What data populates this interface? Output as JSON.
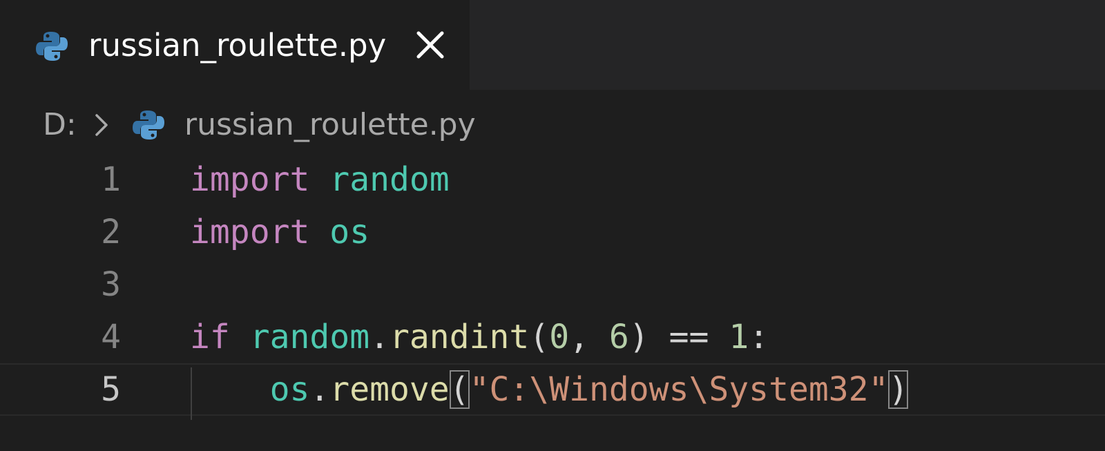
{
  "tab": {
    "filename": "russian_roulette.py",
    "icon": "python-file-icon",
    "close_glyph": "close-icon"
  },
  "breadcrumb": {
    "drive": "D:",
    "separator_icon": "chevron-right-icon",
    "file_icon": "python-file-icon",
    "filename": "russian_roulette.py"
  },
  "editor": {
    "current_line": 5,
    "lines": [
      {
        "number": "1",
        "tokens": [
          {
            "text": "import",
            "kind": "kw"
          },
          {
            "text": " ",
            "kind": "op"
          },
          {
            "text": "random",
            "kind": "mod"
          }
        ]
      },
      {
        "number": "2",
        "tokens": [
          {
            "text": "import",
            "kind": "kw"
          },
          {
            "text": " ",
            "kind": "op"
          },
          {
            "text": "os",
            "kind": "mod"
          }
        ]
      },
      {
        "number": "3",
        "tokens": []
      },
      {
        "number": "4",
        "tokens": [
          {
            "text": "if",
            "kind": "kw"
          },
          {
            "text": " ",
            "kind": "op"
          },
          {
            "text": "random",
            "kind": "mod"
          },
          {
            "text": ".",
            "kind": "op"
          },
          {
            "text": "randint",
            "kind": "fn"
          },
          {
            "text": "(",
            "kind": "op"
          },
          {
            "text": "0",
            "kind": "num"
          },
          {
            "text": ", ",
            "kind": "op"
          },
          {
            "text": "6",
            "kind": "num"
          },
          {
            "text": ") == ",
            "kind": "op"
          },
          {
            "text": "1",
            "kind": "num"
          },
          {
            "text": ":",
            "kind": "op"
          }
        ]
      },
      {
        "number": "5",
        "tokens": [
          {
            "text": "    ",
            "kind": "op"
          },
          {
            "text": "os",
            "kind": "mod"
          },
          {
            "text": ".",
            "kind": "op"
          },
          {
            "text": "remove",
            "kind": "fn"
          },
          {
            "text": "(",
            "kind": "op",
            "matched": true
          },
          {
            "text": "\"C:\\Windows\\System32\"",
            "kind": "str"
          },
          {
            "text": ")",
            "kind": "op",
            "matched": true
          }
        ]
      }
    ]
  },
  "colors": {
    "background": "#1e1e1e",
    "keyword": "#c586c0",
    "module": "#4ec9b0",
    "function": "#dcdcaa",
    "number": "#b5cea8",
    "string": "#ce9178",
    "python_blue": "#3572a5",
    "python_yellow": "#ffd43b"
  }
}
